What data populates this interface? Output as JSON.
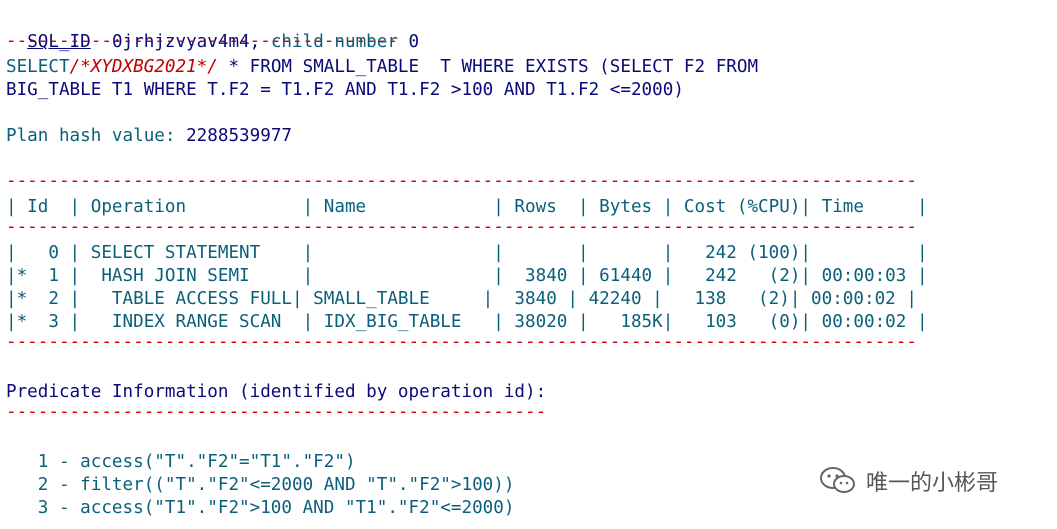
{
  "sql": {
    "id_label": "SQL_ID",
    "id_value": "0jrhjzvyav4m4,",
    "child_label": "child number",
    "child_value": "0",
    "dash_short": "-------------------------------------",
    "text_line1_a": "SELECT",
    "text_line1_hint": "/*XYDXBG2021*/",
    "text_line1_b": " * FROM SMALL_TABLE  T WHERE EXISTS (SELECT F2 FROM",
    "text_line2": "BIG_TABLE T1 WHERE T.F2 = T1.F2 AND T1.F2 >100 AND T1.F2 <=2000)"
  },
  "plan": {
    "hash_label": "Plan hash value:",
    "hash_value": "2288539977",
    "dash_long": "--------------------------------------------------------------------------------------",
    "header": "| Id  | Operation           | Name            | Rows  | Bytes | Cost (%CPU)| Time     |",
    "rows": [
      "|   0 | SELECT STATEMENT    |                 |       |       |   242 (100)|          |",
      "|*  1 |  HASH JOIN SEMI     |                 |  3840 | 61440 |   242   (2)| 00:00:03 |",
      "|*  2 |   TABLE ACCESS FULL| SMALL_TABLE     |  3840 | 42240 |   138   (2)| 00:00:02 |",
      "|*  3 |   INDEX RANGE SCAN  | IDX_BIG_TABLE   | 38020 |   185K|   103   (0)| 00:00:02 |"
    ]
  },
  "predicate": {
    "title": "Predicate Information (identified by operation id):",
    "dash": "---------------------------------------------------",
    "items": [
      "   1 - access(\"T\".\"F2\"=\"T1\".\"F2\")",
      "   2 - filter((\"T\".\"F2\"<=2000 AND \"T\".\"F2\">100))",
      "   3 - access(\"T1\".\"F2\">100 AND \"T1\".\"F2\"<=2000)"
    ]
  },
  "watermark": {
    "text": "唯一的小彬哥",
    "icon": "wechat-icon"
  },
  "colors": {
    "keyword": "#0a5f7a",
    "identifier": "#0a0a7a",
    "dash": "#d40000",
    "hint": "#c00000"
  }
}
